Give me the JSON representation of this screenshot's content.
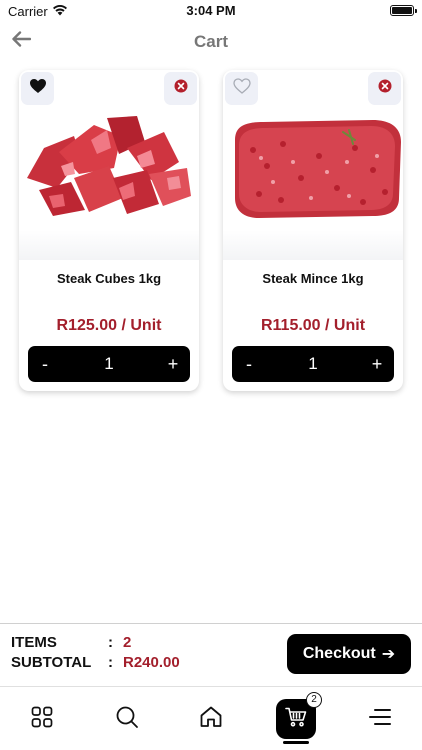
{
  "status_bar": {
    "carrier": "Carrier",
    "time": "3:04 PM"
  },
  "nav": {
    "title": "Cart",
    "back_icon": "arrow-left-icon"
  },
  "colors": {
    "accent": "#a31f2c",
    "primary": "#000000",
    "muted_title": "#777777",
    "chip_bg": "#eef0f7"
  },
  "cart_items": [
    {
      "name": "Steak Cubes 1kg",
      "price": "R125.00 / Unit",
      "quantity": "1",
      "favorited": true,
      "minus_label": "-",
      "plus_label": "+"
    },
    {
      "name": "Steak Mince 1kg",
      "price": "R115.00 / Unit",
      "quantity": "1",
      "favorited": false,
      "minus_label": "-",
      "plus_label": "+"
    }
  ],
  "summary": {
    "items_label": "ITEMS",
    "items_value": "2",
    "subtotal_label": "SUBTOTAL",
    "subtotal_value": "R240.00",
    "separator": ":"
  },
  "checkout": {
    "label": "Checkout",
    "arrow": "➔"
  },
  "tab_bar": {
    "tabs": [
      {
        "name": "categories",
        "icon": "grid-icon"
      },
      {
        "name": "search",
        "icon": "search-icon"
      },
      {
        "name": "home",
        "icon": "home-icon"
      },
      {
        "name": "cart",
        "icon": "cart-icon",
        "active": true
      },
      {
        "name": "menu",
        "icon": "menu-icon"
      }
    ],
    "cart_badge": "2"
  }
}
